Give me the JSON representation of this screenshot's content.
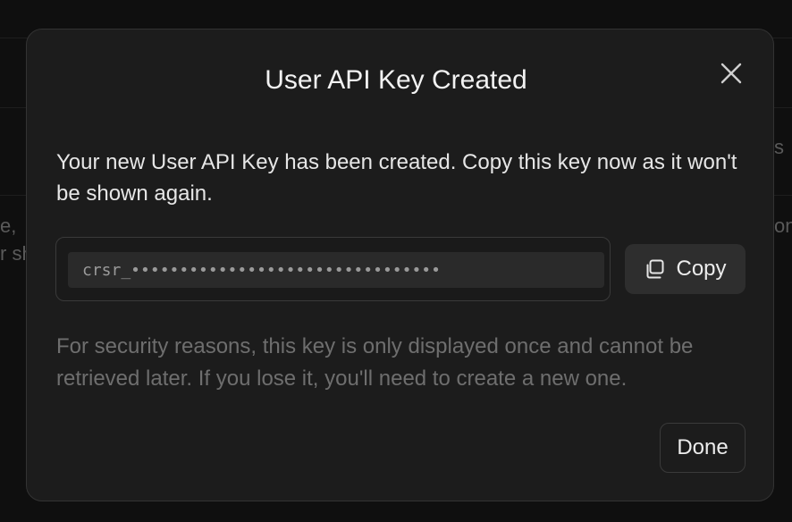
{
  "background": {
    "fragments": [
      "e,",
      "r sh",
      "s",
      "on"
    ]
  },
  "modal": {
    "title": "User API Key Created",
    "close_icon": "close-icon",
    "description": "Your new User API Key has been created. Copy this key now as it won't be shown again.",
    "api_key": {
      "value": "crsr_••••••••••••••••••••••••••••••••"
    },
    "copy_button": {
      "label": "Copy",
      "icon": "copy-icon"
    },
    "security_note": "For security reasons, this key is only displayed once and cannot be retrieved later. If you lose it, you'll need to create a new one.",
    "done_button": {
      "label": "Done"
    }
  },
  "colors": {
    "modal_background": "#1c1c1c",
    "page_background": "#0f0f0f",
    "primary_text": "#f2f2f2",
    "muted_text": "#6e6e6e",
    "button_background": "#2e2e2e"
  }
}
